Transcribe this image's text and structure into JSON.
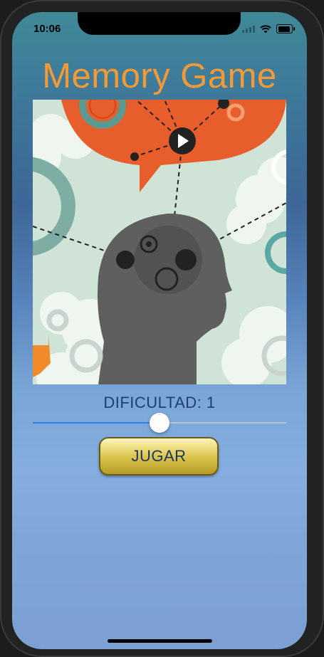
{
  "status_bar": {
    "time": "10:06"
  },
  "app": {
    "title": "Memory Game",
    "difficulty_label": "DIFICULTAD: 1",
    "slider": {
      "value_fraction": 0.5
    },
    "play_button_label": "JUGAR"
  },
  "colors": {
    "title": "#f29a38",
    "slider_active": "#2f7ff0",
    "button_gold": "#d9c24a",
    "speech_bubble": "#e85d2c",
    "head_silhouette": "#5f5f5f"
  }
}
